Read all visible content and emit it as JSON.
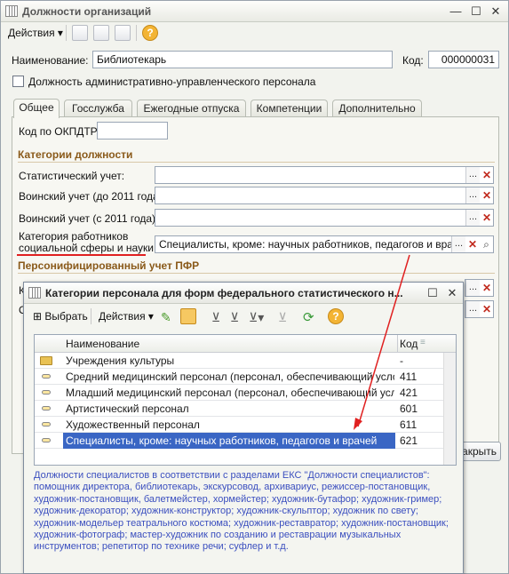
{
  "main": {
    "title": "Должности организаций",
    "actions_label": "Действия",
    "name_label": "Наименование:",
    "name_value": "Библиотекарь",
    "code_label": "Код:",
    "code_value": "000000031",
    "admin_checkbox_label": "Должность административно-управленческого персонала",
    "tabs": [
      "Общее",
      "Госслужба",
      "Ежегодные отпуска",
      "Компетенции",
      "Дополнительно"
    ],
    "okpdtr_label": "Код по ОКПДТР:",
    "okpdtr_value": "",
    "categories_group": "Категории должности",
    "stat_label": "Статистический учет:",
    "military_before_label": "Воинский учет (до 2011 года):",
    "military_after_label": "Воинский учет (с 2011 года):",
    "social_label_line1": "Категория работников",
    "social_label_line2": "социальной сферы и науки:",
    "social_value": "Специалисты, кроме: научных работников, педагогов и врачей",
    "pfr_group": "Персонифицированный учет ПФР",
    "close_label": "Закрыть"
  },
  "popup": {
    "title": "Категории персонала для форм федерального статистического н...",
    "select_label": "Выбрать",
    "actions_label": "Действия",
    "col_name": "Наименование",
    "col_code": "Код",
    "rows": [
      {
        "name": "Учреждения культуры",
        "code": "-",
        "kind": "folder"
      },
      {
        "name": "Средний медицинский персонал (персонал, обеспечивающий услови...",
        "code": "411",
        "kind": "item"
      },
      {
        "name": "Младший медицинский персонал (персонал, обеспечивающий услови...",
        "code": "421",
        "kind": "item"
      },
      {
        "name": "Артистический персонал",
        "code": "601",
        "kind": "item"
      },
      {
        "name": "Художественный персонал",
        "code": "611",
        "kind": "item"
      },
      {
        "name": "Специалисты, кроме: научных работников, педагогов и врачей",
        "code": "621",
        "kind": "item",
        "selected": true
      }
    ],
    "description": "Должности специалистов в соответствии с разделами ЕКС \"Должности специалистов\": помощник директора, библиотекарь, экскурсовод, архивариус, режиссер-постановщик, художник-постановщик, балетмейстер, хормейстер; художник-бутафор; художник-гример; художник-декоратор; художник-конструктор; художник-скульптор; художник по свету; художник-модельер театрального костюма; художник-реставратор; художник-постановщик; художник-фотограф; мастер-художник по созданию и реставрации музыкальных инструментов; репетитор по технике речи; суфлер и т.д."
  },
  "colors": {
    "accent": "#3a66c4",
    "group_title": "#8a5a1a",
    "description": "#3b4fbf",
    "annotation": "#e02020"
  }
}
